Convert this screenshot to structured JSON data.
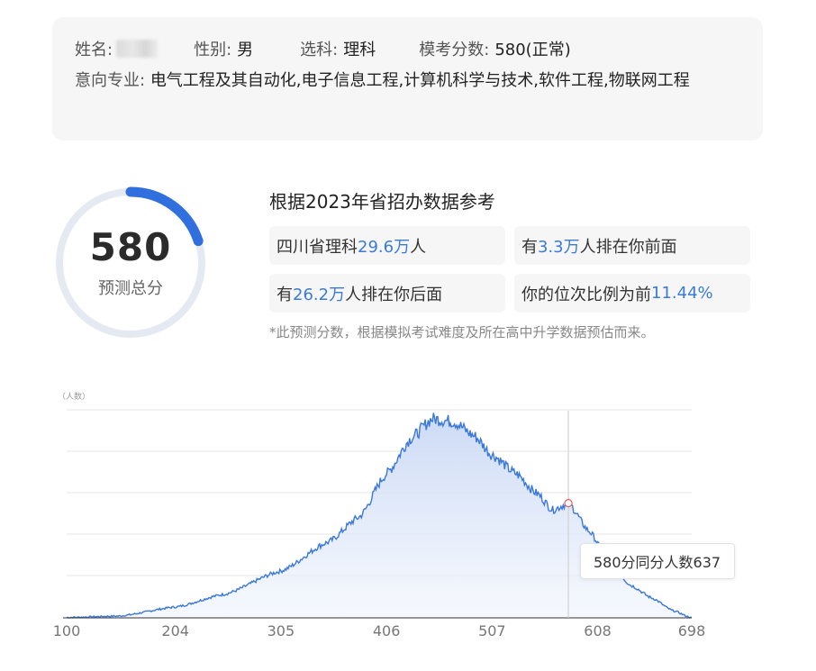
{
  "student": {
    "name_label": "姓名:",
    "gender_label": "性别:",
    "gender": "男",
    "subject_label": "选科:",
    "subject": "理科",
    "mock_label": "模考分数:",
    "mock_score": "580(正常)",
    "major_label": "意向专业:",
    "majors": "电气工程及其自动化,电子信息工程,计算机科学与技术,软件工程,物联网工程"
  },
  "score_ring": {
    "score": "580",
    "label": "预测总分",
    "progress_fraction": 0.2,
    "accent": "#2f6fde",
    "track": "#e5e9f2"
  },
  "reference": {
    "title": "根据2023年省招办数据参考",
    "stats": [
      {
        "pre": "四川省理科",
        "num": "29.6万",
        "post": "人"
      },
      {
        "pre": "有",
        "num": "3.3万",
        "post": "人排在你前面"
      },
      {
        "pre": "有",
        "num": "26.2万",
        "post": "人排在你后面"
      },
      {
        "pre": "你的位次比例为前",
        "num": "11.44%",
        "post": ""
      }
    ],
    "note": "*此预测分数，根据模拟考试难度及所在高中升学数据预估而来。"
  },
  "chart_data": {
    "type": "area",
    "ylabel": "（人数）",
    "x_ticks": [
      "100",
      "204",
      "305",
      "406",
      "507",
      "608",
      "698"
    ],
    "xlim": [
      100,
      698
    ],
    "highlight_x": 580,
    "tooltip": "580分同分人数637",
    "line_color": "#3a78d8",
    "points": [
      [
        100,
        2
      ],
      [
        150,
        10
      ],
      [
        204,
        60
      ],
      [
        250,
        130
      ],
      [
        305,
        260
      ],
      [
        350,
        420
      ],
      [
        380,
        560
      ],
      [
        406,
        800
      ],
      [
        430,
        1000
      ],
      [
        450,
        1105
      ],
      [
        470,
        1090
      ],
      [
        490,
        1010
      ],
      [
        507,
        905
      ],
      [
        530,
        800
      ],
      [
        550,
        690
      ],
      [
        565,
        600
      ],
      [
        580,
        637
      ],
      [
        600,
        480
      ],
      [
        620,
        300
      ],
      [
        640,
        180
      ],
      [
        660,
        110
      ],
      [
        680,
        40
      ],
      [
        698,
        0
      ]
    ]
  }
}
